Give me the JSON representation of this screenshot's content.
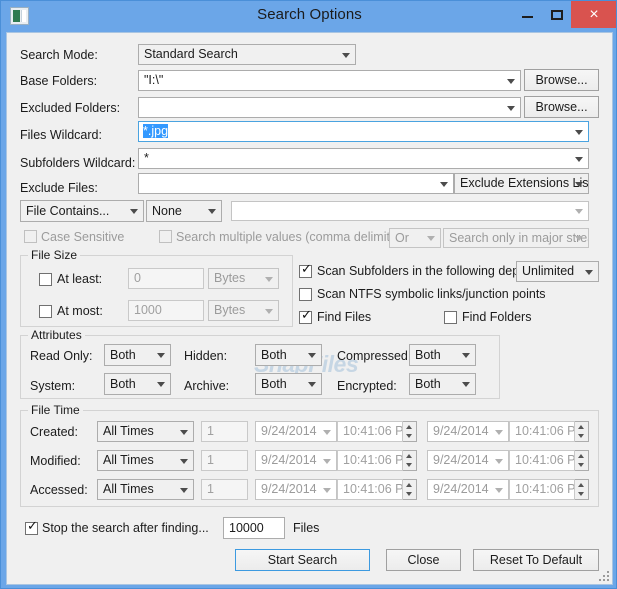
{
  "window": {
    "title": "Search Options",
    "icon": "app-icon",
    "buttons": {
      "minimize": "minimize-icon",
      "maximize": "maximize-icon",
      "close": "×"
    },
    "close_color": "#d9534f",
    "titlebar_color": "#6ba6e8"
  },
  "watermark": "SnapFiles",
  "fields": {
    "search_mode": {
      "label": "Search Mode:",
      "value": "Standard Search"
    },
    "base_folders": {
      "label": "Base Folders:",
      "value": "\"I:\\\"",
      "browse": "Browse..."
    },
    "excluded_folders": {
      "label": "Excluded Folders:",
      "value": "",
      "browse": "Browse..."
    },
    "files_wildcard": {
      "label": "Files Wildcard:",
      "value": "*.jpg",
      "selected": true
    },
    "subfolders_wildcard": {
      "label": "Subfolders Wildcard:",
      "value": "*"
    },
    "exclude_files": {
      "label": "Exclude Files:",
      "value": "",
      "extensions_list": "Exclude Extensions List"
    }
  },
  "contains_row": {
    "mode": "File Contains...",
    "type": "None",
    "value": ""
  },
  "options_row": {
    "case_sensitive": {
      "label": "Case Sensitive",
      "checked": false,
      "disabled": true
    },
    "multiple_values": {
      "label": "Search multiple values (comma delimited)",
      "checked": false,
      "disabled": true
    },
    "operator": "Or",
    "streams": "Search only in major strea"
  },
  "file_size": {
    "title": "File Size",
    "at_least": {
      "label": "At least:",
      "checked": false,
      "value": "0",
      "unit": "Bytes"
    },
    "at_most": {
      "label": "At most:",
      "checked": false,
      "value": "1000",
      "unit": "Bytes"
    }
  },
  "scan_options": {
    "scan_subfolders": {
      "label": "Scan Subfolders in the following depth:",
      "checked": true,
      "depth": "Unlimited"
    },
    "scan_ntfs": {
      "label": "Scan NTFS symbolic links/junction points",
      "checked": false
    },
    "find_files": {
      "label": "Find Files",
      "checked": true
    },
    "find_folders": {
      "label": "Find Folders",
      "checked": false
    }
  },
  "attributes": {
    "title": "Attributes",
    "items": [
      {
        "label": "Read Only:",
        "value": "Both"
      },
      {
        "label": "Hidden:",
        "value": "Both"
      },
      {
        "label": "Compressed:",
        "value": "Both"
      },
      {
        "label": "System:",
        "value": "Both"
      },
      {
        "label": "Archive:",
        "value": "Both"
      },
      {
        "label": "Encrypted:",
        "value": "Both"
      }
    ]
  },
  "file_time": {
    "title": "File Time",
    "rows": [
      {
        "label": "Created:",
        "mode": "All Times",
        "count": "1",
        "date1": "9/24/2014",
        "time1": "10:41:06 P",
        "date2": "9/24/2014",
        "time2": "10:41:06 P"
      },
      {
        "label": "Modified:",
        "mode": "All Times",
        "count": "1",
        "date1": "9/24/2014",
        "time1": "10:41:06 P",
        "date2": "9/24/2014",
        "time2": "10:41:06 P"
      },
      {
        "label": "Accessed:",
        "mode": "All Times",
        "count": "1",
        "date1": "9/24/2014",
        "time1": "10:41:06 P",
        "date2": "9/24/2014",
        "time2": "10:41:06 P"
      }
    ]
  },
  "stop_search": {
    "label": "Stop the search after finding...",
    "checked": true,
    "count": "10000",
    "unit": "Files"
  },
  "footer": {
    "start": "Start Search",
    "close": "Close",
    "reset": "Reset To Default"
  }
}
